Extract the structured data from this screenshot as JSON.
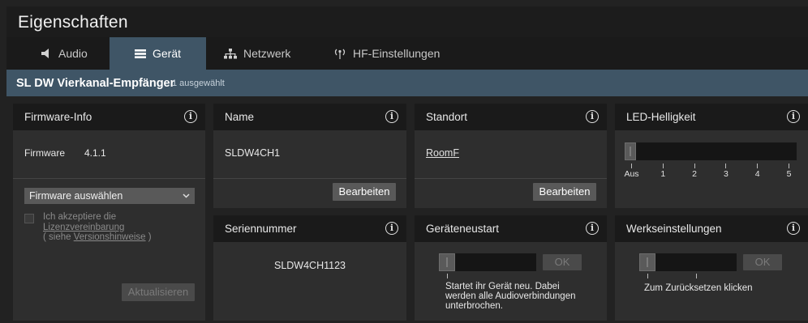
{
  "window": {
    "title": "Eigenschaften"
  },
  "tabs": [
    {
      "label": "Audio",
      "icon": "speaker-icon"
    },
    {
      "label": "Gerät",
      "icon": "menu-icon"
    },
    {
      "label": "Netzwerk",
      "icon": "network-icon"
    },
    {
      "label": "HF-Einstellungen",
      "icon": "antenna-icon"
    }
  ],
  "active_tab": "Gerät",
  "device": {
    "name": "SL DW Vierkanal-Empfänger",
    "selection": "1 ausgewählt"
  },
  "firmware": {
    "title": "Firmware-Info",
    "label": "Firmware",
    "version": "4.1.1",
    "select_label": "Firmware auswählen",
    "accept_prefix": "Ich akzeptiere die",
    "license_link": "Lizenzvereinbarung",
    "versions_open": "( siehe ",
    "versions_link": "Versionshinweise",
    "versions_close": " )",
    "update_button": "Aktualisieren"
  },
  "name_card": {
    "title": "Name",
    "value": "SLDW4CH1",
    "edit_button": "Bearbeiten"
  },
  "location_card": {
    "title": "Standort",
    "value": "RoomF",
    "edit_button": "Bearbeiten"
  },
  "led_card": {
    "title": "LED-Helligkeit",
    "level": 0,
    "scale_labels": [
      "Aus",
      "1",
      "2",
      "3",
      "4",
      "5"
    ]
  },
  "serial_card": {
    "title": "Seriennummer",
    "value": "SLDW4CH1123"
  },
  "restart_card": {
    "title": "Geräteneustart",
    "ok_button": "OK",
    "description": "Startet ihr Gerät neu. Dabei werden alle Audioverbindungen unterbrochen."
  },
  "factory_card": {
    "title": "Werkseinstellungen",
    "ok_button": "OK",
    "description": "Zum Zurücksetzen klicken"
  },
  "colors": {
    "accent": "#3f5566",
    "panel": "#2e2e2e",
    "header": "#1a1a1a",
    "button": "#595959"
  }
}
